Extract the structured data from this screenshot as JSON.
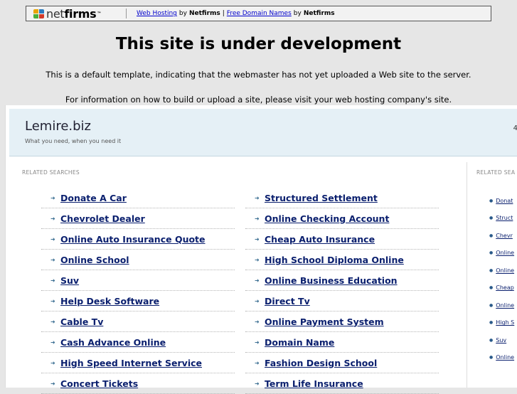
{
  "topbar": {
    "logo_net": "net",
    "logo_firms": "firms",
    "logo_tm": "™",
    "link1": "Web Hosting",
    "by1": "by",
    "brand1": "Netfirms",
    "divider": "|",
    "link2": "Free Domain Names",
    "by2": "by",
    "brand2": "Netfirms",
    "logo_colors": [
      "#e8a400",
      "#2a7bc0",
      "#4caf3c",
      "#d23a2a"
    ]
  },
  "notice": {
    "title": "This site is under development",
    "line1": "This is a default template, indicating that the webmaster has not yet uploaded a Web site to the server.",
    "line2": "For information on how to build or upload a site, please visit your web hosting company's site."
  },
  "site": {
    "title": "Lemire.biz",
    "tagline": "What you need, when you need it",
    "header_mark": "4"
  },
  "related": {
    "label": "RELATED SEARCHES",
    "col1": [
      "Donate A Car",
      "Chevrolet Dealer",
      "Online Auto Insurance Quote",
      "Online School",
      "Suv",
      "Help Desk Software",
      "Cable Tv",
      "Cash Advance Online",
      "High Speed Internet Service",
      "Concert Tickets"
    ],
    "col2": [
      "Structured Settlement",
      "Online Checking Account",
      "Cheap Auto Insurance",
      "High School Diploma Online",
      "Online Business Education",
      "Direct Tv",
      "Online Payment System",
      "Domain Name",
      "Fashion Design School",
      "Term Life Insurance"
    ]
  },
  "sidebar": {
    "label": "RELATED SEA",
    "items": [
      "Donat",
      "Struct",
      "Chevr",
      "Online",
      "Online",
      "Cheap",
      "Online",
      "High S",
      "Suv",
      "Online"
    ]
  }
}
